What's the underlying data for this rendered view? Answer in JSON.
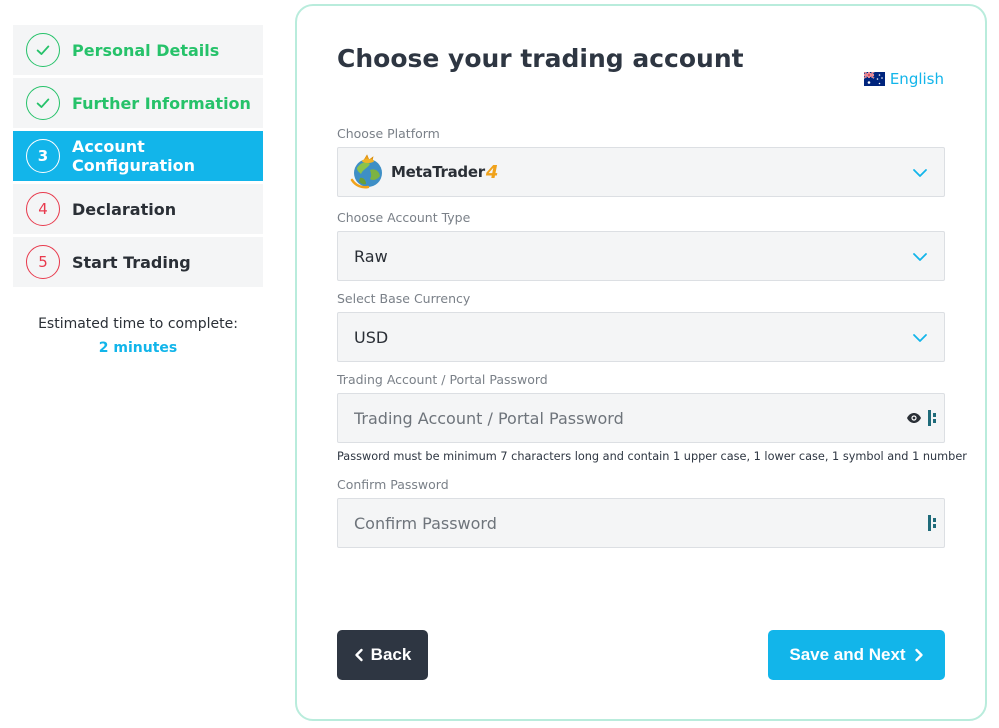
{
  "steps": [
    {
      "number": "1",
      "label": "Personal Details",
      "state": "done"
    },
    {
      "number": "2",
      "label": "Further Information",
      "state": "done"
    },
    {
      "number": "3",
      "label": "Account Configuration",
      "state": "active"
    },
    {
      "number": "4",
      "label": "Declaration",
      "state": "todo"
    },
    {
      "number": "5",
      "label": "Start Trading",
      "state": "todo"
    }
  ],
  "estimate": {
    "label": "Estimated time to complete:",
    "value": "2 minutes"
  },
  "form": {
    "title": "Choose your trading account",
    "language": {
      "label": "English",
      "icon": "australia-flag-icon"
    },
    "platform": {
      "label": "Choose Platform",
      "logo_text": "MetaTrader",
      "logo_number": "4"
    },
    "account_type": {
      "label": "Choose Account Type",
      "value": "Raw"
    },
    "currency": {
      "label": "Select Base Currency",
      "value": "USD"
    },
    "password": {
      "label": "Trading Account / Portal Password",
      "placeholder": "Trading Account / Portal Password",
      "hint": "Password must be minimum 7 characters long and contain 1 upper case, 1 lower case, 1 symbol and 1 number"
    },
    "confirm_password": {
      "label": "Confirm Password",
      "placeholder": "Confirm Password"
    },
    "back_label": "Back",
    "next_label": "Save and Next"
  },
  "colors": {
    "accent": "#12b5ea",
    "success": "#26c26a",
    "pending": "#e83a4d",
    "dark": "#2e3642",
    "card_border": "#b9ecdc"
  }
}
